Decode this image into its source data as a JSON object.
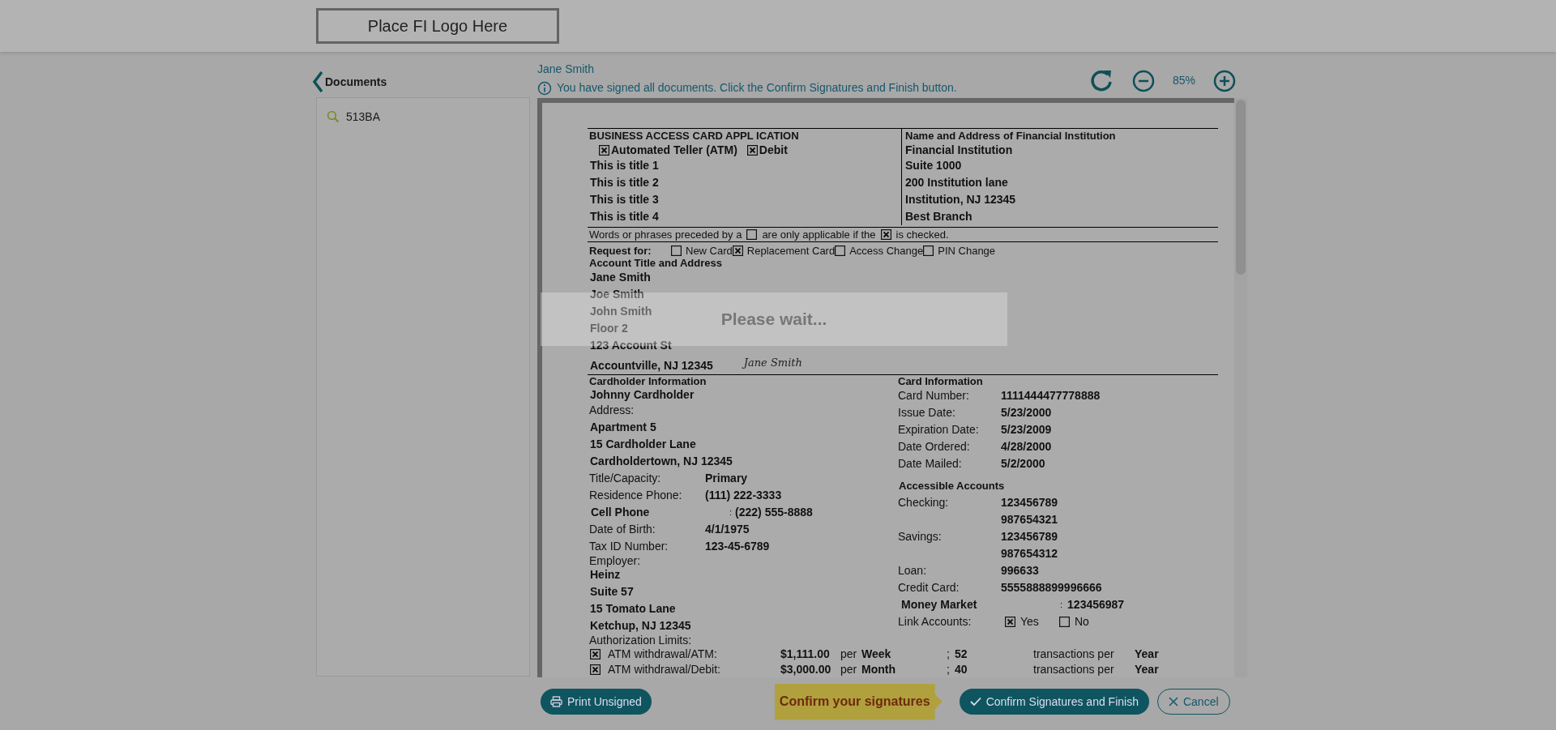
{
  "header": {
    "logo_text": "Place FI Logo Here"
  },
  "sidebar": {
    "title": "Documents",
    "search_value": "513BA"
  },
  "main": {
    "signer_name": "Jane Smith",
    "info_message": "You have signed all documents. Click the Confirm Signatures and Finish button.",
    "zoom_level": "85%"
  },
  "document": {
    "title": "BUSINESS ACCESS CARD APPL ICATION",
    "card_types": [
      {
        "label": "Automated Teller (ATM)",
        "checked": true
      },
      {
        "label": "Debit",
        "checked": true
      }
    ],
    "titles": [
      "This is title 1",
      "This is title 2",
      "This is title 3",
      "This is title 4"
    ],
    "institution_heading": "Name and Address of Financial Institution",
    "institution_lines": [
      "Financial Institution",
      "Suite 1000",
      "200 Institution lane",
      "Institution, NJ 12345",
      "Best Branch"
    ],
    "note": [
      {
        "kind": "text",
        "text": "Words or phrases preceded by a"
      },
      {
        "kind": "checkbox",
        "checked": false
      },
      {
        "kind": "text",
        "text": "are only applicable if the"
      },
      {
        "kind": "checkbox",
        "checked": true
      },
      {
        "kind": "text",
        "text": "is checked."
      }
    ],
    "request_label": "Request for:",
    "request_options": [
      {
        "label": "New Card",
        "checked": false
      },
      {
        "label": "Replacement Card",
        "checked": true
      },
      {
        "label": "Access Change",
        "checked": false
      },
      {
        "label": "PIN Change",
        "checked": false
      }
    ],
    "account_heading": "Account Title and Address",
    "account_lines": [
      "Jane Smith",
      "Joe Smith",
      "John Smith",
      "Floor 2",
      "123 Account St",
      "Accountville, NJ 12345"
    ],
    "signature": "Jane Smith",
    "cardholder_heading": "Cardholder Information",
    "cardholder_name": "Johnny Cardholder",
    "address_label": "Address:",
    "address_lines": [
      "Apartment 5",
      "15 Cardholder Lane",
      "Cardholdertown, NJ 12345"
    ],
    "cardholder_fields": [
      {
        "kind": "plain",
        "label": "Title/Capacity:",
        "value": "Primary"
      },
      {
        "kind": "plain",
        "label": "Residence Phone:",
        "value": "(111) 222-3333"
      },
      {
        "kind": "bold",
        "label": "Cell Phone",
        "colon": ":",
        "value": "(222) 555-8888"
      },
      {
        "kind": "plain",
        "label": "Date of Birth:",
        "value": "4/1/1975"
      },
      {
        "kind": "plain",
        "label": "Tax ID Number:",
        "value": "123-45-6789"
      }
    ],
    "employer_label": "Employer:",
    "employer_lines": [
      "Heinz",
      "Suite 57",
      "15 Tomato Lane",
      "Ketchup, NJ 12345"
    ],
    "card_heading": "Card Information",
    "card_fields": [
      {
        "label": "Card Number:",
        "value": "1111444477778888"
      },
      {
        "label": "Issue Date:",
        "value": "5/23/2000"
      },
      {
        "label": "Expiration Date:",
        "value": "5/23/2009"
      },
      {
        "label": "Date Ordered:",
        "value": "4/28/2000"
      },
      {
        "label": "Date Mailed:",
        "value": "5/2/2000"
      }
    ],
    "accounts_heading": "Accessible Accounts",
    "accounts": [
      {
        "kind": "plain",
        "label": "Checking:",
        "values": [
          "123456789",
          "987654321"
        ]
      },
      {
        "kind": "plain",
        "label": "Savings:",
        "values": [
          "123456789",
          "987654312"
        ]
      },
      {
        "kind": "plain",
        "label": "Loan:",
        "values": [
          "996633"
        ]
      },
      {
        "kind": "plain",
        "label": "Credit Card:",
        "values": [
          "5555888899996666"
        ]
      },
      {
        "kind": "bold",
        "label": "Money Market",
        "colon": ":",
        "values": [
          "123456987"
        ]
      }
    ],
    "link_label": "Link Accounts:",
    "link_options": [
      {
        "label": "Yes",
        "checked": true
      },
      {
        "label": "No",
        "checked": false
      }
    ],
    "authorization_label": "Authorization Limits:",
    "limits": [
      {
        "checked": true,
        "label": "ATM withdrawal/ATM:",
        "amount": "$1,111.00",
        "per": "per",
        "period": "Week",
        "separator": ";",
        "count": "52",
        "transactions": "transactions per",
        "unit": "Year"
      },
      {
        "checked": true,
        "label": "ATM withdrawal/Debit:",
        "amount": "$3,000.00",
        "per": "per",
        "period": "Month",
        "separator": ";",
        "count": "40",
        "transactions": "transactions per",
        "unit": "Year"
      }
    ]
  },
  "overlay": {
    "message": "Please wait..."
  },
  "footer": {
    "print_button": "Print Unsigned",
    "callout": "Confirm your signatures",
    "confirm_button": "Confirm Signatures and Finish",
    "cancel_button": "Cancel"
  }
}
